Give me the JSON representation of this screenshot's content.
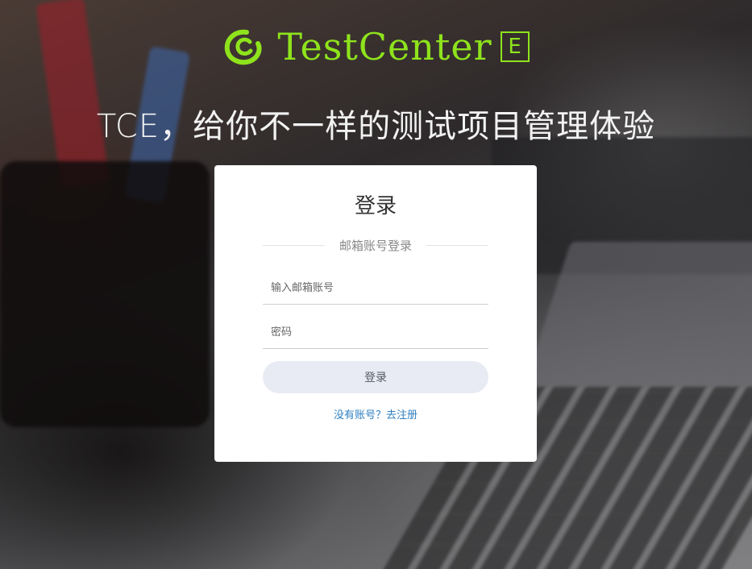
{
  "brand": {
    "name": "TestCenter",
    "badge": "E",
    "color": "#8ee31c",
    "icon": "swirl-logo-icon"
  },
  "slogan": "TCE，给你不一样的测试项目管理体验",
  "login": {
    "title": "登录",
    "subtitle": "邮箱账号登录",
    "email_placeholder": "输入邮箱账号",
    "password_placeholder": "密码",
    "submit_label": "登录",
    "register_link": "没有账号？去注册"
  },
  "colors": {
    "button_bg": "#e8ebf3",
    "link": "#2f7fc1"
  }
}
